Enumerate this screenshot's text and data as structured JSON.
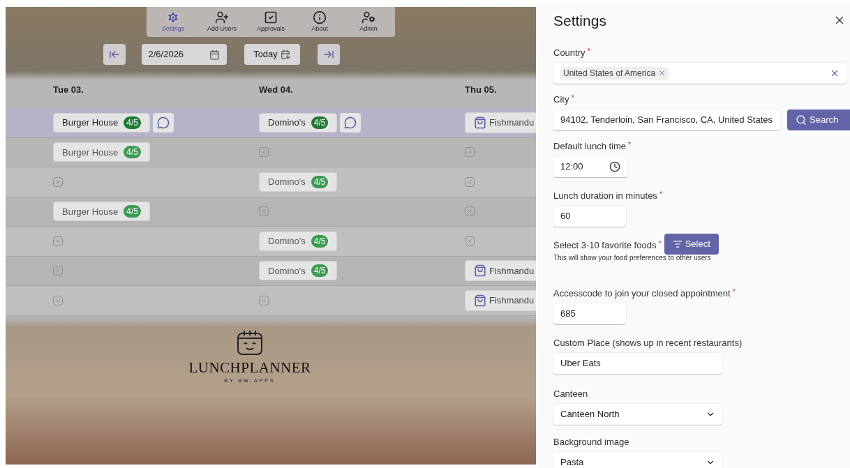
{
  "nav": [
    {
      "label": "Settings",
      "selected": true
    },
    {
      "label": "Add Users",
      "selected": false
    },
    {
      "label": "Approvals",
      "selected": false
    },
    {
      "label": "About",
      "selected": false
    },
    {
      "label": "Admin",
      "selected": false
    }
  ],
  "date_picker": {
    "value": "2/6/2026"
  },
  "today_button": "Today",
  "days": [
    "Tue 03.",
    "Wed 04.",
    "Thu 05."
  ],
  "rows": [
    {
      "selected": true,
      "cells": [
        {
          "kind": "booking",
          "name": "Burger House",
          "badge": "4/5",
          "comment": true
        },
        {
          "kind": "booking",
          "name": "Domino's",
          "badge": "4/5",
          "comment": true
        },
        {
          "kind": "delivery",
          "name": "Fishmandu"
        }
      ]
    },
    {
      "selected": false,
      "cells": [
        {
          "kind": "booking",
          "name": "Burger House",
          "badge": "4/5",
          "comment": false
        },
        {
          "kind": "empty"
        },
        {
          "kind": "empty"
        }
      ]
    },
    {
      "selected": false,
      "cells": [
        {
          "kind": "empty"
        },
        {
          "kind": "booking",
          "name": "Domino's",
          "badge": "4/5",
          "comment": false
        },
        {
          "kind": "empty"
        }
      ]
    },
    {
      "selected": false,
      "cells": [
        {
          "kind": "booking",
          "name": "Burger House",
          "badge": "4/5",
          "comment": false
        },
        {
          "kind": "empty"
        },
        {
          "kind": "empty"
        }
      ]
    },
    {
      "selected": false,
      "cells": [
        {
          "kind": "empty"
        },
        {
          "kind": "booking",
          "name": "Domino's",
          "badge": "4/5",
          "comment": false
        },
        {
          "kind": "empty"
        }
      ]
    },
    {
      "selected": false,
      "cells": [
        {
          "kind": "empty"
        },
        {
          "kind": "booking",
          "name": "Domino's",
          "badge": "4/5",
          "comment": false
        },
        {
          "kind": "delivery",
          "name": "Fishmandu"
        }
      ]
    },
    {
      "selected": false,
      "cells": [
        {
          "kind": "empty"
        },
        {
          "kind": "empty"
        },
        {
          "kind": "delivery",
          "name": "Fishmandu"
        }
      ]
    }
  ],
  "logo": {
    "name": "LUNCHPLANNER",
    "tagline": "BY BW-APPS"
  },
  "settings": {
    "title": "Settings",
    "fields": [
      {
        "kind": "tags",
        "label": "Country",
        "required_mark": "*",
        "tags": [
          "United States of America"
        ]
      },
      {
        "kind": "search",
        "label": "City",
        "required_mark": "*",
        "value": "94102, Tenderloin, San Francisco, CA, United States",
        "button": "Search"
      },
      {
        "kind": "time",
        "label": "Default lunch time",
        "required_mark": "*",
        "value": "12:00"
      },
      {
        "kind": "text",
        "label": "Lunch duration in minutes",
        "required_mark": "*",
        "value": "60"
      },
      {
        "kind": "picker",
        "label": "Select 3-10 favorite foods",
        "required_mark": "*",
        "button": "Select",
        "hint": "This will show your food preferences to other users"
      },
      {
        "kind": "text",
        "label": "Accesscode to join your closed appointment",
        "required_mark": "*",
        "value": "685"
      },
      {
        "kind": "text-wide",
        "label": "Custom Place (shows up in recent restaurants)",
        "value": "Uber Eats"
      },
      {
        "kind": "dropdown",
        "label": "Canteen",
        "value": "Canteen North"
      },
      {
        "kind": "dropdown",
        "label": "Background image",
        "value": "Pasta"
      }
    ]
  }
}
